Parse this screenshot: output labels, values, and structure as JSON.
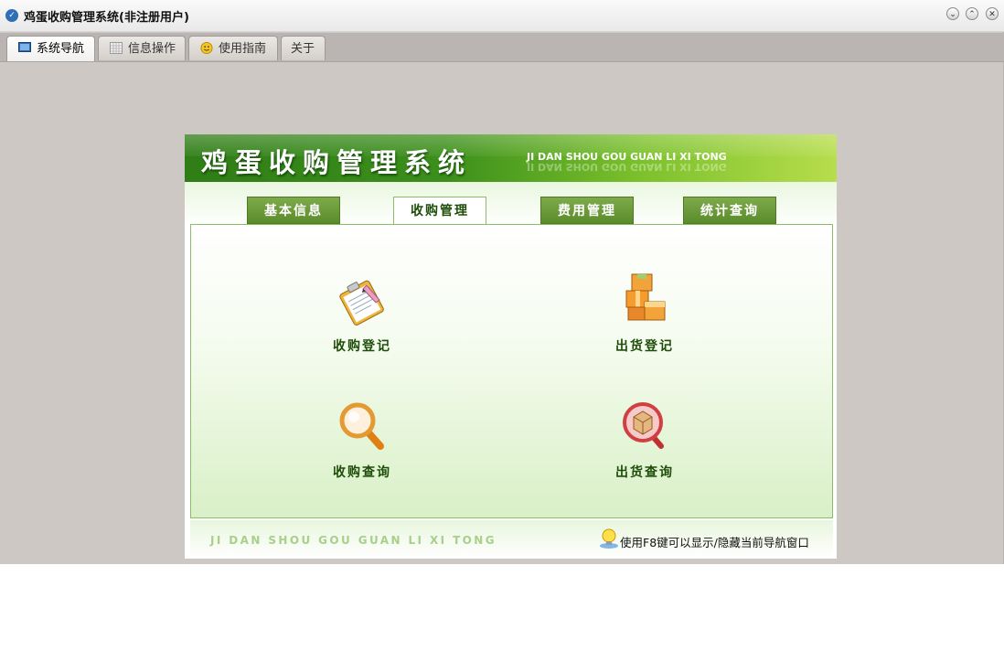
{
  "window": {
    "title": "鸡蛋收购管理系统(非注册用户)",
    "icon": "app-logo-icon",
    "controls": [
      "minimize-icon",
      "restore-icon",
      "close-icon"
    ]
  },
  "tabs": [
    {
      "label": "系统导航",
      "icon": "monitor-icon",
      "active": true
    },
    {
      "label": "信息操作",
      "icon": "grid-icon",
      "active": false
    },
    {
      "label": "使用指南",
      "icon": "smiley-icon",
      "active": false
    },
    {
      "label": "关于",
      "icon": "",
      "active": false
    }
  ],
  "nav": {
    "banner_title": "鸡蛋收购管理系统",
    "banner_subtitle": "JI DAN SHOU GOU GUAN LI XI TONG",
    "tabs": [
      {
        "label": "基本信息",
        "active": false
      },
      {
        "label": "收购管理",
        "active": true
      },
      {
        "label": "费用管理",
        "active": false
      },
      {
        "label": "统计查询",
        "active": false
      }
    ],
    "items": [
      {
        "label": "收购登记",
        "icon": "clipboard-pencil-icon"
      },
      {
        "label": "出货登记",
        "icon": "boxes-icon"
      },
      {
        "label": "收购查询",
        "icon": "magnifier-icon"
      },
      {
        "label": "出货查询",
        "icon": "package-search-icon"
      }
    ],
    "footer_text": "JI DAN SHOU GOU GUAN LI XI TONG",
    "hint_text": "使用F8键可以显示/隐藏当前导航窗口",
    "hint_icon": "lightbulb-icon"
  },
  "colors": {
    "banner_dark": "#2f7d16",
    "banner_light": "#b7dd4c",
    "label_green": "#1e4d0a",
    "window_bg": "#cdc8c4"
  }
}
